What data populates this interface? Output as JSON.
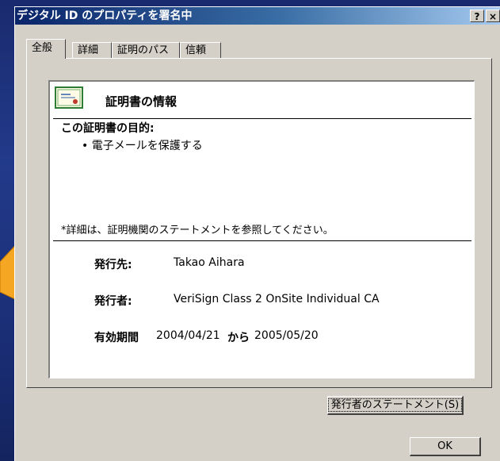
{
  "window": {
    "title": "デジタル ID のプロパティを署名中",
    "help_label": "?",
    "close_label": "×"
  },
  "tabs": [
    {
      "label": "全般"
    },
    {
      "label": "詳細"
    },
    {
      "label": "証明のパス"
    },
    {
      "label": "信頼"
    }
  ],
  "info": {
    "header": "証明書の情報",
    "purpose_heading": "この証明書の目的:",
    "purpose_item": "• 電子メールを保護する",
    "note": "*詳細は、証明機関のステートメントを参照してください。",
    "issued_to_label": "発行先:",
    "issued_to_value": "Takao Aihara",
    "issued_by_label": "発行者:",
    "issued_by_value": "VeriSign Class 2 OnSite Individual CA",
    "validity_label": "有効期間",
    "valid_from": "2004/04/21",
    "valid_to_label": "から",
    "valid_to": "2005/05/20"
  },
  "buttons": {
    "issuer_statement": "発行者のステートメント(S)",
    "ok": "OK"
  },
  "colors": {
    "title_gradient_start": "#0a246a",
    "title_gradient_end": "#a6caf0",
    "dialog_face": "#d4d0c8",
    "arrow": "#f5a623"
  },
  "icons": [
    "certificate-icon",
    "help-icon",
    "close-icon"
  ]
}
